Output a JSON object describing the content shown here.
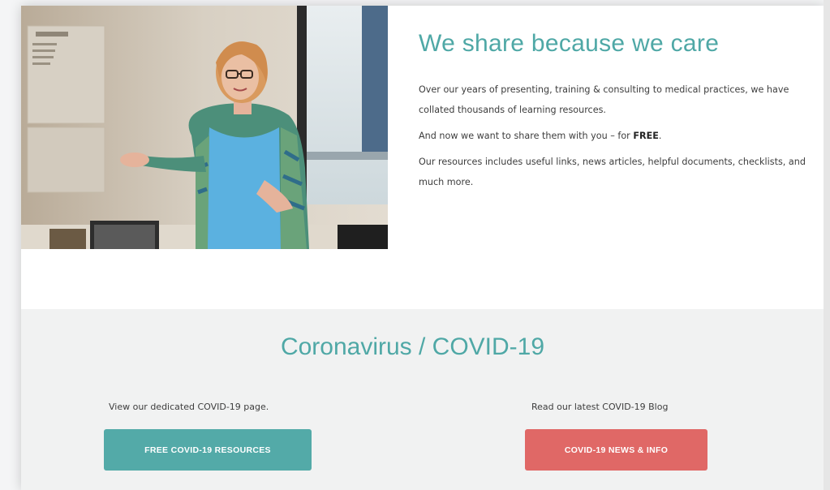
{
  "hero": {
    "title": "We share because we care",
    "paragraphs": {
      "p1": "Over our years of presenting, training & consulting to medical practices, we have collated thousands of learning resources.",
      "p2_prefix": "And now we want to share them with you – for ",
      "p2_bold": "FREE",
      "p2_suffix": ".",
      "p3": "Our resources includes useful links, news articles, helpful documents, checklists, and much more."
    }
  },
  "covid": {
    "title": "Coronavirus / COVID-19",
    "left_text": "View our dedicated COVID-19 page.",
    "left_button": "FREE COVID-19 RESOURCES",
    "right_text": "Read our latest COVID-19 Blog",
    "right_button": "COVID-19 NEWS & INFO"
  },
  "colors": {
    "accent_teal": "#4fa8a6",
    "button_teal": "#53aaa8",
    "button_red": "#e06866",
    "section_bg": "#f1f2f2"
  }
}
